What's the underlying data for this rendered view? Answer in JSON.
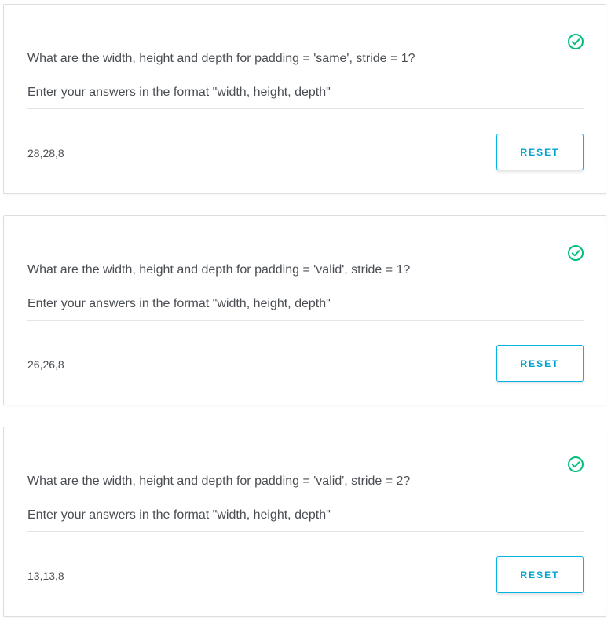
{
  "colors": {
    "accent": "#02b3e4",
    "success": "#02c07a",
    "text": "#4a4e53",
    "border": "#dcdfe2"
  },
  "quizzes": [
    {
      "status_icon": "check-circle-icon",
      "question": "What are the width, height and depth for padding = 'same', stride = 1?",
      "instruction": "Enter your answers in the format \"width, height, depth\"",
      "answer": "28,28,8",
      "reset_label": "RESET"
    },
    {
      "status_icon": "check-circle-icon",
      "question": "What are the width, height and depth for padding = 'valid', stride = 1?",
      "instruction": "Enter your answers in the format \"width, height, depth\"",
      "answer": "26,26,8",
      "reset_label": "RESET"
    },
    {
      "status_icon": "check-circle-icon",
      "question": "What are the width, height and depth for padding = 'valid', stride = 2?",
      "instruction": "Enter your answers in the format \"width, height, depth\"",
      "answer": "13,13,8",
      "reset_label": "RESET"
    }
  ]
}
